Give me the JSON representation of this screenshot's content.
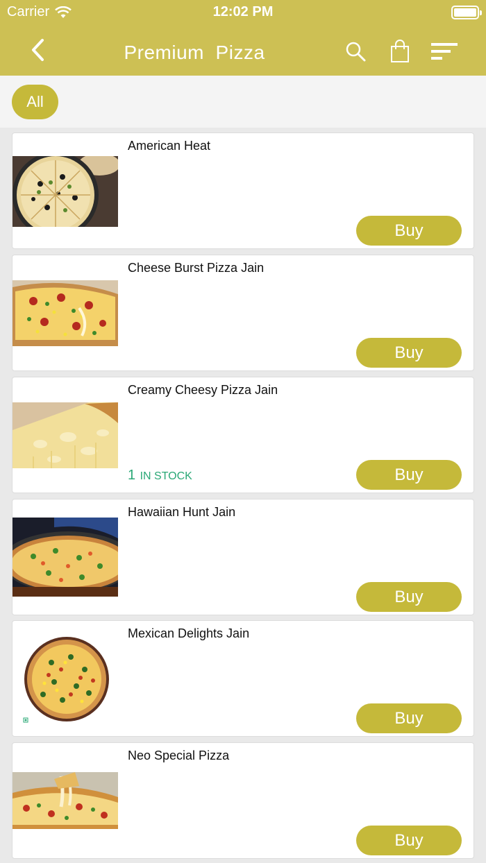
{
  "status_bar": {
    "carrier": "Carrier",
    "time": "12:02 PM"
  },
  "header": {
    "title": "Premium  Pizza"
  },
  "filters": [
    {
      "label": "All"
    }
  ],
  "products": [
    {
      "name": "American Heat",
      "buy_label": "Buy"
    },
    {
      "name": "Cheese Burst Pizza Jain",
      "buy_label": "Buy"
    },
    {
      "name": "Creamy Cheesy Pizza Jain",
      "buy_label": "Buy",
      "stock_qty": "1",
      "stock_label": "IN STOCK"
    },
    {
      "name": "Hawaiian Hunt Jain",
      "buy_label": "Buy"
    },
    {
      "name": "Mexican Delights Jain",
      "buy_label": "Buy"
    },
    {
      "name": "Neo Special Pizza",
      "buy_label": "Buy"
    }
  ],
  "colors": {
    "header": "#cdc054",
    "button": "#c5b93a",
    "stock": "#2aa876"
  }
}
